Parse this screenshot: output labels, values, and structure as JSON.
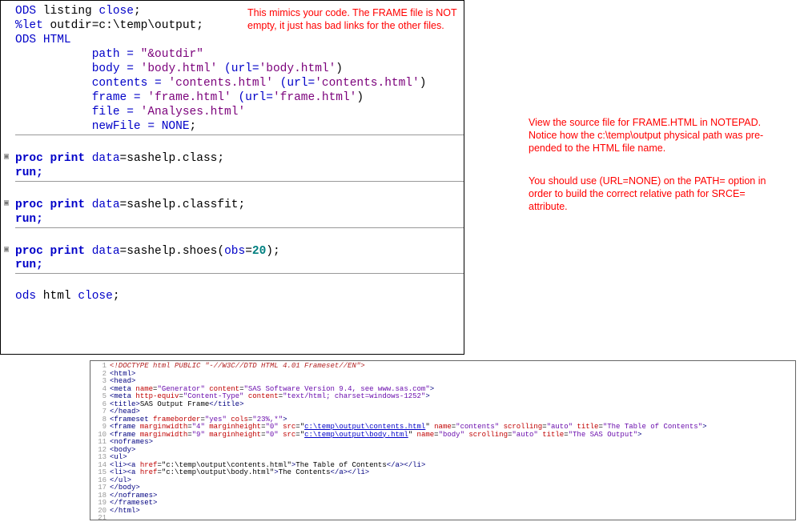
{
  "annotations": {
    "mimics": "This mimics your code. The FRAME file is NOT empty, it just has bad links for the other files.",
    "view_source": "View the source file for FRAME.HTML in NOTEPAD. Notice how the c:\\temp\\output physical path was pre-pended to the HTML file name.",
    "url_none": "You should use (URL=NONE) on the PATH= option in order to build the correct relative path for SRCE= attribute."
  },
  "sas_code": {
    "l01a": "ODS",
    "l01b": " listing ",
    "l01c": "close",
    "l01d": ";",
    "l02a": "%let",
    "l02b": " outdir=c:\\temp\\output;",
    "l03a": "ODS",
    "l03b": " ",
    "l03c": "HTML",
    "l04a": "           path = ",
    "l04b": "\"&outdir\"",
    "l05a": "           body = ",
    "l05b": "'body.html'",
    "l05c": " (url=",
    "l05d": "'body.html'",
    "l05e": ")",
    "l06a": "           contents = ",
    "l06b": "'contents.html'",
    "l06c": " (url=",
    "l06d": "'contents.html'",
    "l06e": ")",
    "l07a": "           frame = ",
    "l07b": "'frame.html'",
    "l07c": " (url=",
    "l07d": "'frame.html'",
    "l07e": ")",
    "l08a": "           file = ",
    "l08b": "'Analyses.html'",
    "l09a": "           newFile = ",
    "l09b": "NONE",
    "l09c": ";",
    "l10a": "proc",
    "l10b": " ",
    "l10c": "print",
    "l10d": " ",
    "l10e": "data",
    "l10f": "=sashelp.class;",
    "l11": "run;",
    "l12a": "proc",
    "l12b": " ",
    "l12c": "print",
    "l12d": " ",
    "l12e": "data",
    "l12f": "=sashelp.classfit;",
    "l13": "run;",
    "l14a": "proc",
    "l14b": " ",
    "l14c": "print",
    "l14d": " ",
    "l14e": "data",
    "l14f": "=sashelp.shoes(",
    "l14g": "obs",
    "l14h": "=",
    "l14i": "20",
    "l14j": ");",
    "l15": "run;",
    "l16a": "ods",
    "l16b": " html ",
    "l16c": "close",
    "l16d": ";"
  },
  "html_source": {
    "n1": "1",
    "l1": "<!DOCTYPE html PUBLIC \"-//W3C//DTD HTML 4.01 Frameset//EN\">",
    "n2": "2",
    "l2a": "<",
    "l2b": "html",
    "l2c": ">",
    "n3": "3",
    "l3a": "<",
    "l3b": "head",
    "l3c": ">",
    "n4": "4",
    "l4a": "<",
    "l4b": "meta",
    "l4c": " ",
    "l4d": "name",
    "l4e": "=",
    "l4f": "\"Generator\"",
    "l4g": " ",
    "l4h": "content",
    "l4i": "=",
    "l4j": "\"SAS Software Version 9.4, see www.sas.com\"",
    "l4k": ">",
    "n5": "5",
    "l5a": "<",
    "l5b": "meta",
    "l5c": " ",
    "l5d": "http-equiv",
    "l5e": "=",
    "l5f": "\"Content-Type\"",
    "l5g": " ",
    "l5h": "content",
    "l5i": "=",
    "l5j": "\"text/html; charset=windows-1252\"",
    "l5k": ">",
    "n6": "6",
    "l6a": "<",
    "l6b": "title",
    "l6c": ">",
    "l6d": "SAS Output Frame",
    "l6e": "</",
    "l6f": "title",
    "l6g": ">",
    "n7": "7",
    "l7a": "</",
    "l7b": "head",
    "l7c": ">",
    "n8": "8",
    "l8a": "<",
    "l8b": "frameset",
    "l8c": " ",
    "l8d": "frameborder",
    "l8e": "=",
    "l8f": "\"yes\"",
    "l8g": " ",
    "l8h": "cols",
    "l8i": "=",
    "l8j": "\"23%,*\"",
    "l8k": ">",
    "n9": "9",
    "l9a": "<",
    "l9b": "frame",
    "l9c": " ",
    "l9d": "marginwidth",
    "l9e": "=",
    "l9f": "\"4\"",
    "l9g": " ",
    "l9h": "marginheight",
    "l9i": "=",
    "l9j": "\"0\"",
    "l9k": " ",
    "l9l": "src",
    "l9m": "=\"",
    "l9n": "c:\\temp\\output\\contents.html",
    "l9o": "\" ",
    "l9p": "name",
    "l9q": "=",
    "l9r": "\"contents\"",
    "l9s": " ",
    "l9t": "scrolling",
    "l9u": "=",
    "l9v": "\"auto\"",
    "l9w": " ",
    "l9x": "title",
    "l9y": "=",
    "l9z": "\"The Table of Contents\"",
    "l9aa": ">",
    "n10": "10",
    "l10za": "<",
    "l10zb": "frame",
    "l10zc": " ",
    "l10zd": "marginwidth",
    "l10ze": "=",
    "l10zf": "\"9\"",
    "l10zg": " ",
    "l10zh": "marginheight",
    "l10zi": "=",
    "l10zj": "\"0\"",
    "l10zk": " ",
    "l10zl": "src",
    "l10zm": "=\"",
    "l10zn": "c:\\temp\\output\\body.html",
    "l10zo": "\" ",
    "l10zp": "name",
    "l10zq": "=",
    "l10zr": "\"body\"",
    "l10zs": " ",
    "l10zt": "scrolling",
    "l10zu": "=",
    "l10zv": "\"auto\"",
    "l10zw": " ",
    "l10zx": "title",
    "l10zy": "=",
    "l10zz": "\"The SAS Output\"",
    "l10zaa": ">",
    "n11": "11",
    "l11a": "<",
    "l11b": "noframes",
    "l11c": ">",
    "n12": "12",
    "l12a": "<",
    "l12b": "body",
    "l12c": ">",
    "n13": "13",
    "l13a": "<",
    "l13b": "ul",
    "l13c": ">",
    "n14": "14",
    "l14za": "<",
    "l14zb": "li",
    "l14zc": "><",
    "l14zd": "a",
    "l14ze": " ",
    "l14zf": "href",
    "l14zg": "=",
    "l14zh": "\"c:\\temp\\output\\contents.html\"",
    "l14zi": ">",
    "l14zj": "The Table of Contents",
    "l14zk": "</",
    "l14zl": "a",
    "l14zm": "></",
    "l14zn": "li",
    "l14zo": ">",
    "n15": "15",
    "l15za": "<",
    "l15zb": "li",
    "l15zc": "><",
    "l15zd": "a",
    "l15ze": " ",
    "l15zf": "href",
    "l15zg": "=",
    "l15zh": "\"c:\\temp\\output\\body.html\"",
    "l15zi": ">",
    "l15zj": "The Contents",
    "l15zk": "</",
    "l15zl": "a",
    "l15zm": "></",
    "l15zn": "li",
    "l15zo": ">",
    "n16": "16",
    "l16a": "</",
    "l16b": "ul",
    "l16c": ">",
    "n17": "17",
    "l17a": "</",
    "l17b": "body",
    "l17c": ">",
    "n18": "18",
    "l18a": "</",
    "l18b": "noframes",
    "l18c": ">",
    "n19": "19",
    "l19a": "</",
    "l19b": "frameset",
    "l19c": ">",
    "n20": "20",
    "l20a": "</",
    "l20b": "html",
    "l20c": ">",
    "n21": "21"
  }
}
